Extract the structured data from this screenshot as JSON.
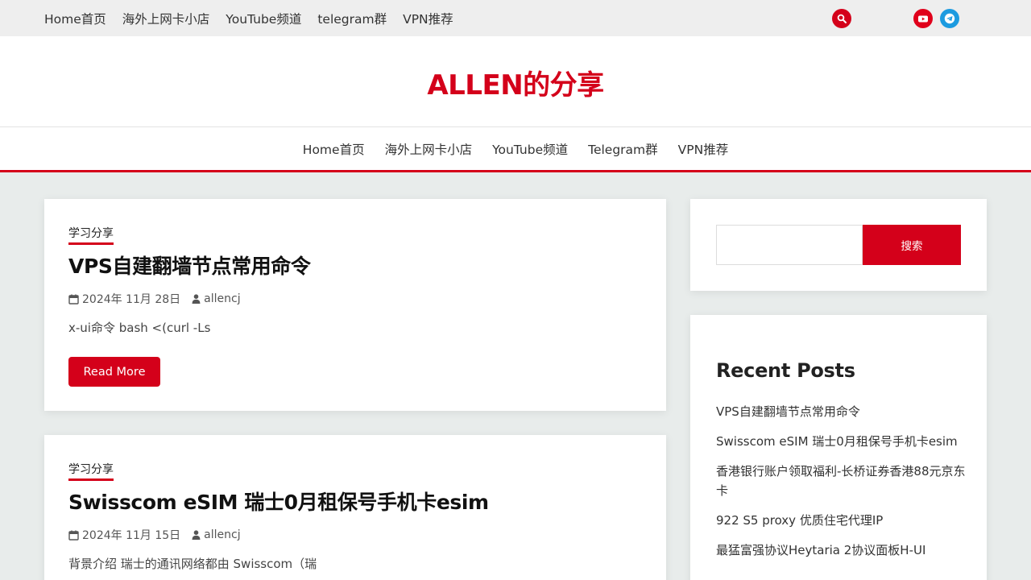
{
  "topbar": {
    "nav": [
      "Home首页",
      "海外上网卡小店",
      "YouTube频道",
      "telegram群",
      "VPN推荐"
    ],
    "icons": [
      "search-icon",
      "youtube-icon",
      "telegram-icon"
    ]
  },
  "header": {
    "site_title": "ALLEN的分享"
  },
  "mainnav": {
    "items": [
      "Home首页",
      "海外上网卡小店",
      "YouTube频道",
      "Telegram群",
      "VPN推荐"
    ]
  },
  "posts": [
    {
      "category": "学习分享",
      "title": "VPS自建翻墙节点常用命令",
      "date": "2024年 11月 28日",
      "author": "allencj",
      "excerpt": "x-ui命令 bash <(curl -Ls",
      "read_more": "Read More"
    },
    {
      "category": "学习分享",
      "title": "Swisscom eSIM 瑞士0月租保号手机卡esim",
      "date": "2024年 11月 15日",
      "author": "allencj",
      "excerpt": "背景介绍 瑞士的通讯网络都由 Swisscom（瑞"
    }
  ],
  "sidebar": {
    "search": {
      "placeholder": "",
      "button_label": "搜索"
    },
    "recent": {
      "title": "Recent Posts",
      "items": [
        "VPS自建翻墙节点常用命令",
        "Swisscom eSIM 瑞士0月租保号手机卡esim",
        "香港银行账户领取福利-长桥证券香港88元京东卡",
        "922 S5 proxy 优质住宅代理IP",
        "最猛富强协议Heytaria 2协议面板H-UI"
      ]
    }
  },
  "colors": {
    "accent": "#d4001a",
    "telegram": "#1c9be0",
    "background": "#e8eceb"
  }
}
